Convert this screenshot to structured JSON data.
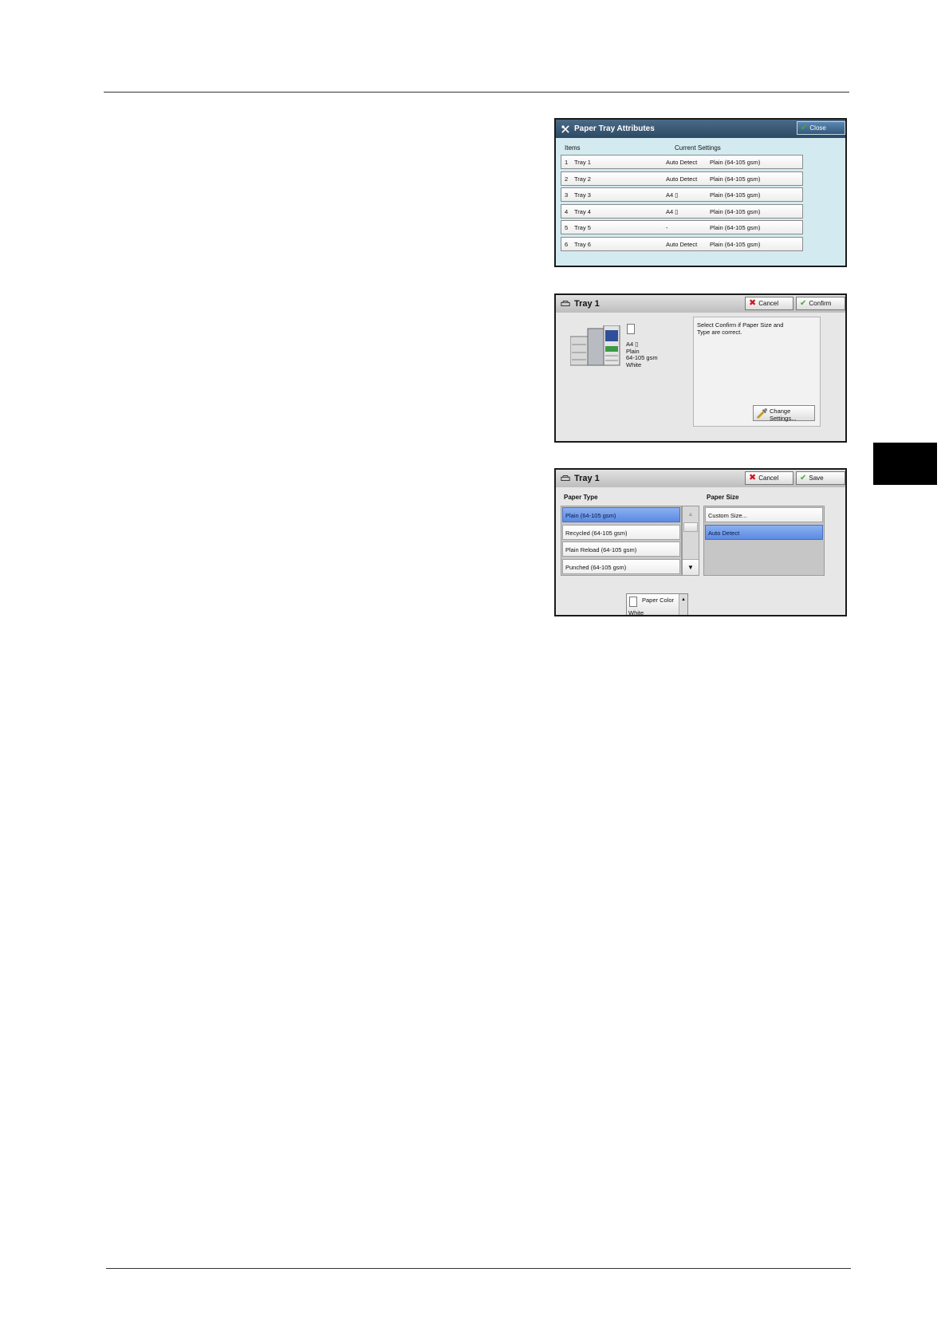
{
  "panel_tray_attributes": {
    "title": "Paper Tray Attributes",
    "close_label": "Close",
    "col_items": "Items",
    "col_current": "Current Settings",
    "rows": [
      {
        "num": "1",
        "name": "Tray 1",
        "size": "Auto Detect",
        "type": "Plain (64-105 gsm)"
      },
      {
        "num": "2",
        "name": "Tray 2",
        "size": "Auto Detect",
        "type": "Plain (64-105 gsm)"
      },
      {
        "num": "3",
        "name": "Tray 3",
        "size": "A4 ▯",
        "type": "Plain (64-105 gsm)"
      },
      {
        "num": "4",
        "name": "Tray 4",
        "size": "A4 ▯",
        "type": "Plain (64-105 gsm)"
      },
      {
        "num": "5",
        "name": "Tray 5",
        "size": "-",
        "type": "Plain (64-105 gsm)"
      },
      {
        "num": "6",
        "name": "Tray 6",
        "size": "Auto Detect",
        "type": "Plain (64-105 gsm)"
      }
    ]
  },
  "panel_tray_confirm": {
    "title": "Tray 1",
    "cancel_label": "Cancel",
    "confirm_label": "Confirm",
    "tray_size": "A4 ▯",
    "tray_type": "Plain",
    "tray_weight": "64-105 gsm",
    "tray_color": "White",
    "message": "Select Confirm if Paper Size and Type are correct.",
    "change_line1": "Change",
    "change_line2": "Settings..."
  },
  "panel_tray_settings": {
    "title": "Tray 1",
    "cancel_label": "Cancel",
    "save_label": "Save",
    "paper_type_label": "Paper Type",
    "paper_size_label": "Paper Size",
    "paper_types": [
      {
        "label": "Plain (64-105 gsm)"
      },
      {
        "label": "Recycled (64-105 gsm)"
      },
      {
        "label": "Plain Reload (64-105 gsm)"
      },
      {
        "label": "Punched (64-105 gsm)"
      }
    ],
    "paper_sizes": [
      {
        "label": "Custom Size..."
      },
      {
        "label": "Auto Detect"
      }
    ],
    "paper_color_label": "Paper Color",
    "paper_color_value": "White"
  },
  "colors": {
    "selected": "#6a95e8",
    "titlebar_blue": "#3a5874",
    "panel_bg": "#d3ebf0",
    "side_tab": "#000000"
  }
}
